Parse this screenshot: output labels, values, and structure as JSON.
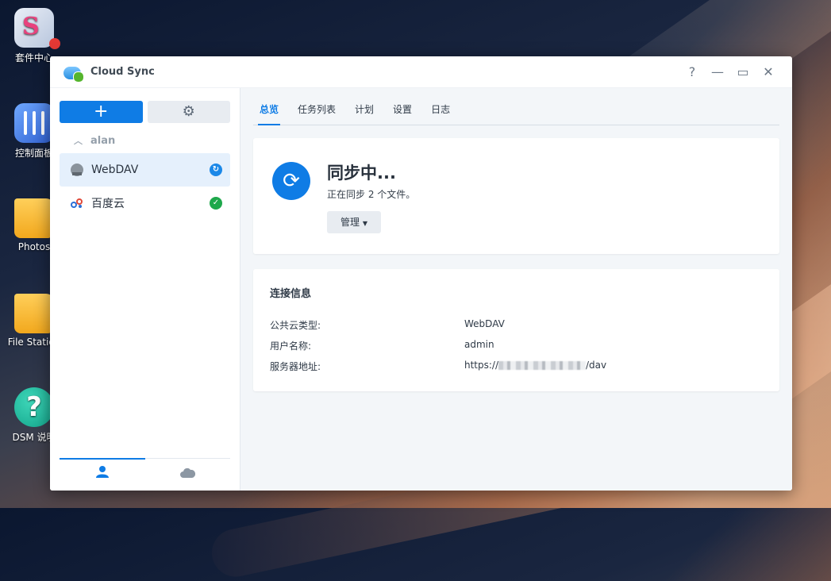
{
  "desktop": {
    "icons": [
      {
        "label": "套件中心"
      },
      {
        "label": "控制面板"
      },
      {
        "label": "Photos"
      },
      {
        "label": "File Station"
      },
      {
        "label": "DSM 说明"
      }
    ]
  },
  "window": {
    "title": "Cloud Sync",
    "controls": {
      "help": "?",
      "minimize": "—",
      "maximize": "▭",
      "close": "✕"
    }
  },
  "sidebar": {
    "add_label": "+",
    "settings_icon": "gear-icon",
    "group": {
      "name": "alan"
    },
    "connections": [
      {
        "name": "WebDAV",
        "icon": "webdav-icon",
        "status": "syncing",
        "active": true
      },
      {
        "name": "百度云",
        "icon": "baidu-cloud-icon",
        "status": "ok",
        "active": false
      }
    ],
    "bottom_tabs": [
      {
        "icon": "user-icon",
        "active": true
      },
      {
        "icon": "cloud-icon",
        "active": false
      }
    ]
  },
  "main": {
    "tabs": [
      {
        "label": "总览",
        "active": true
      },
      {
        "label": "任务列表",
        "active": false
      },
      {
        "label": "计划",
        "active": false
      },
      {
        "label": "设置",
        "active": false
      },
      {
        "label": "日志",
        "active": false
      }
    ],
    "status": {
      "title": "同步中...",
      "subtitle": "正在同步 2 个文件。",
      "manage_label": "管理"
    },
    "connection_info": {
      "title": "连接信息",
      "rows": [
        {
          "label": "公共云类型:",
          "value": "WebDAV"
        },
        {
          "label": "用户名称:",
          "value": "admin"
        },
        {
          "label": "服务器地址:",
          "value_prefix": "https://",
          "value_suffix": "/dav"
        }
      ]
    }
  },
  "colors": {
    "accent": "#0f7ce5",
    "ok": "#1ea84b",
    "sync": "#1b88e8"
  }
}
